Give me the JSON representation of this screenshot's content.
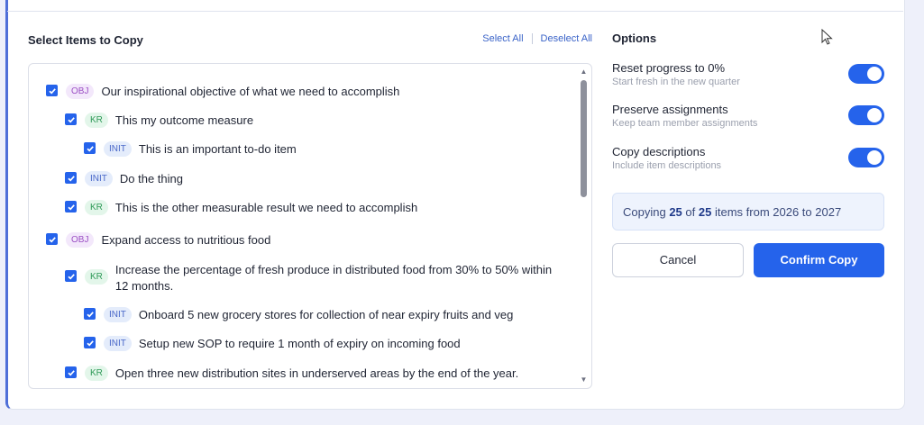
{
  "selection": {
    "title": "Select Items to Copy",
    "select_all": "Select All",
    "deselect_all": "Deselect All"
  },
  "items": [
    {
      "tag": "OBJ",
      "text": "Our inspirational objective of what we need to accomplish",
      "checked": true
    },
    {
      "tag": "KR",
      "text": "This my outcome measure",
      "checked": true
    },
    {
      "tag": "INIT",
      "text": "This is an important to-do item",
      "checked": true
    },
    {
      "tag": "INIT",
      "text": "Do the thing",
      "checked": true
    },
    {
      "tag": "KR",
      "text": "This is the other measurable result we need to accomplish",
      "checked": true
    },
    {
      "tag": "OBJ",
      "text": "Expand access to nutritious food",
      "checked": true
    },
    {
      "tag": "KR",
      "text": "Increase the percentage of fresh produce in distributed food from 30% to 50% within 12 months.",
      "checked": true
    },
    {
      "tag": "INIT",
      "text": "Onboard 5 new grocery stores for collection of near expiry fruits and veg",
      "checked": true
    },
    {
      "tag": "INIT",
      "text": "Setup new SOP to require 1 month of expiry on incoming food",
      "checked": true
    },
    {
      "tag": "KR",
      "text": "Open three new distribution sites in underserved areas by the end of the year.",
      "checked": true
    }
  ],
  "options": {
    "title": "Options",
    "reset": {
      "label": "Reset progress to 0%",
      "desc": "Start fresh in the new quarter",
      "on": true
    },
    "preserve": {
      "label": "Preserve assignments",
      "desc": "Keep team member assignments",
      "on": true
    },
    "descriptions": {
      "label": "Copy descriptions",
      "desc": "Include item descriptions",
      "on": true
    }
  },
  "summary": {
    "prefix": "Copying",
    "count": "25",
    "of": "of",
    "total": "25",
    "suffix": "items from 2026 to 2027"
  },
  "actions": {
    "cancel": "Cancel",
    "confirm": "Confirm Copy"
  },
  "colors": {
    "accent": "#2563eb",
    "obj_tag": "#9b4fc4",
    "kr_tag": "#2f9a58",
    "init_tag": "#4a68c9"
  }
}
